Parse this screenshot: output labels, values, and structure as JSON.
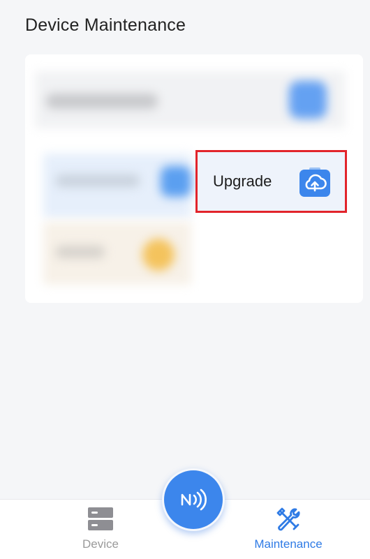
{
  "header": {
    "title": "Device Maintenance"
  },
  "card": {
    "upgrade_tile": {
      "label": "Upgrade",
      "icon": "cloud-upload-icon"
    }
  },
  "highlight_color": "#e2242b",
  "accent_color": "#3c86ec",
  "nfc_button": {
    "icon": "nfc-icon"
  },
  "tabbar": {
    "tabs": [
      {
        "label": "Device",
        "icon": "server-icon",
        "active": false
      },
      {
        "label": "Maintenance",
        "icon": "tools-icon",
        "active": true
      }
    ]
  }
}
